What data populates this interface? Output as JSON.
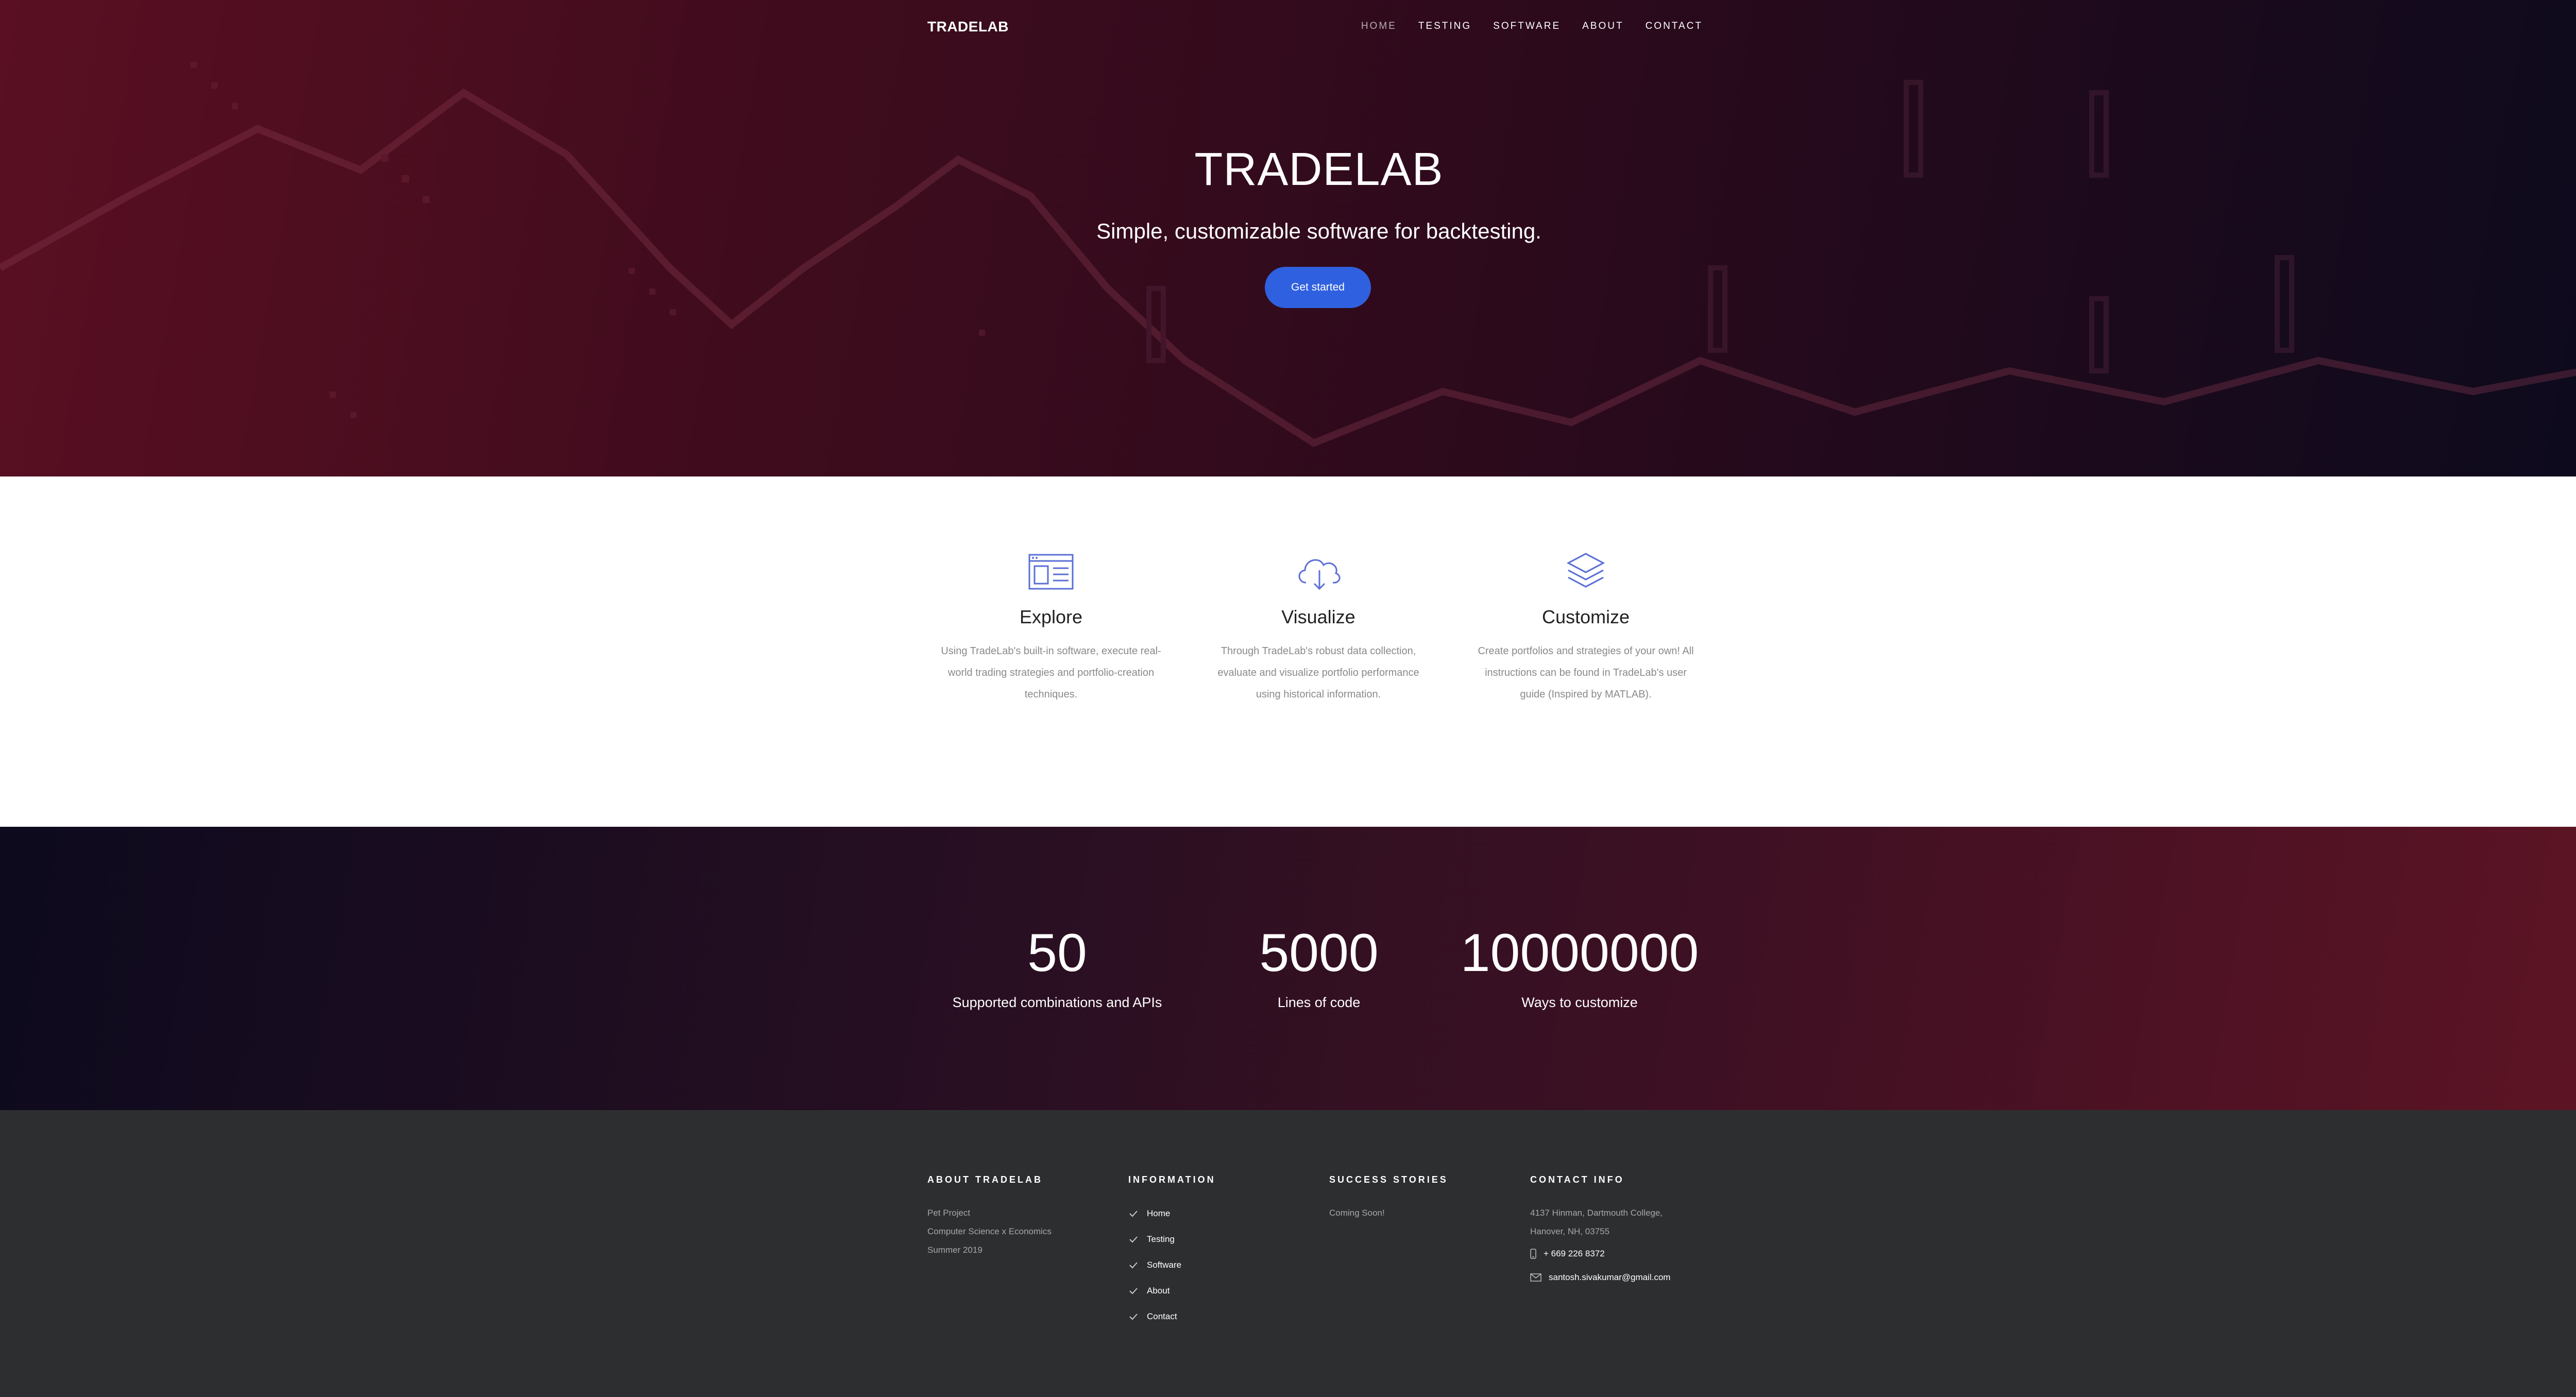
{
  "nav": {
    "brand": "TRADELAB",
    "items": [
      {
        "label": "HOME",
        "active": true
      },
      {
        "label": "TESTING"
      },
      {
        "label": "SOFTWARE"
      },
      {
        "label": "ABOUT"
      },
      {
        "label": "CONTACT"
      }
    ]
  },
  "hero": {
    "title": "TRADELAB",
    "subtitle": "Simple, customizable software for backtesting.",
    "cta": "Get started"
  },
  "features": [
    {
      "icon": "browser-window-icon",
      "title": "Explore",
      "text": "Using TradeLab's built-in software, execute real-world trading strategies and portfolio-creation techniques."
    },
    {
      "icon": "cloud-download-icon",
      "title": "Visualize",
      "text": "Through TradeLab's robust data collection, evaluate and visualize portfolio performance using historical information."
    },
    {
      "icon": "stacked-layers-icon",
      "title": "Customize",
      "text": "Create portfolios and strategies of your own! All instructions can be found in TradeLab's user guide (Inspired by MATLAB)."
    }
  ],
  "stats": [
    {
      "value": "50",
      "label": "Supported combinations and APIs"
    },
    {
      "value": "5000",
      "label": "Lines of code"
    },
    {
      "value": "10000000",
      "label": "Ways to customize"
    }
  ],
  "footer": {
    "about": {
      "heading": "ABOUT TRADELAB",
      "lines": [
        "Pet Project",
        "Computer Science x Economics",
        "Summer 2019"
      ]
    },
    "information": {
      "heading": "INFORMATION",
      "links": [
        "Home",
        "Testing",
        "Software",
        "About",
        "Contact"
      ]
    },
    "success": {
      "heading": "SUCCESS STORIES",
      "text": "Coming Soon!"
    },
    "contact": {
      "heading": "CONTACT INFO",
      "address_1": "4137 Hinman, Dartmouth College,",
      "address_2": "Hanover, NH, 03755",
      "phone": "+ 669 226 8372",
      "email": "santosh.sivakumar@gmail.com"
    }
  },
  "colors": {
    "accent": "#2f60df",
    "hero_left": "#5a0f22",
    "hero_right": "#0c0a1d",
    "footer": "#2d2e30",
    "icon": "#5b6fd6"
  }
}
